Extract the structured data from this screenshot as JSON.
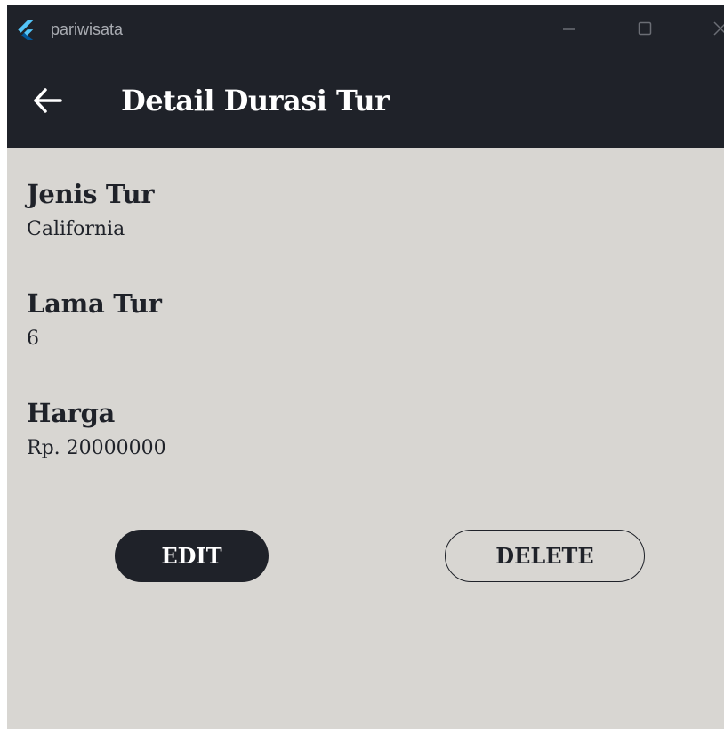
{
  "window": {
    "title": "pariwisata",
    "icons": {
      "app": "flutter-logo-icon",
      "minimize": "minimize-icon",
      "maximize": "maximize-icon",
      "close": "close-icon"
    }
  },
  "appbar": {
    "back_icon": "arrow-left-icon",
    "title": "Detail Durasi Tur"
  },
  "details": [
    {
      "label": "Jenis Tur",
      "value": "California"
    },
    {
      "label": "Lama Tur",
      "value": "6"
    },
    {
      "label": "Harga",
      "value": "Rp. 20000000"
    }
  ],
  "actions": {
    "edit_label": "EDIT",
    "delete_label": "DELETE"
  },
  "colors": {
    "primary_dark": "#1f2229",
    "background": "#d8d6d2",
    "on_primary": "#ffffff",
    "flutter_blue_light": "#54c5f8",
    "flutter_blue_dark": "#01579b"
  }
}
